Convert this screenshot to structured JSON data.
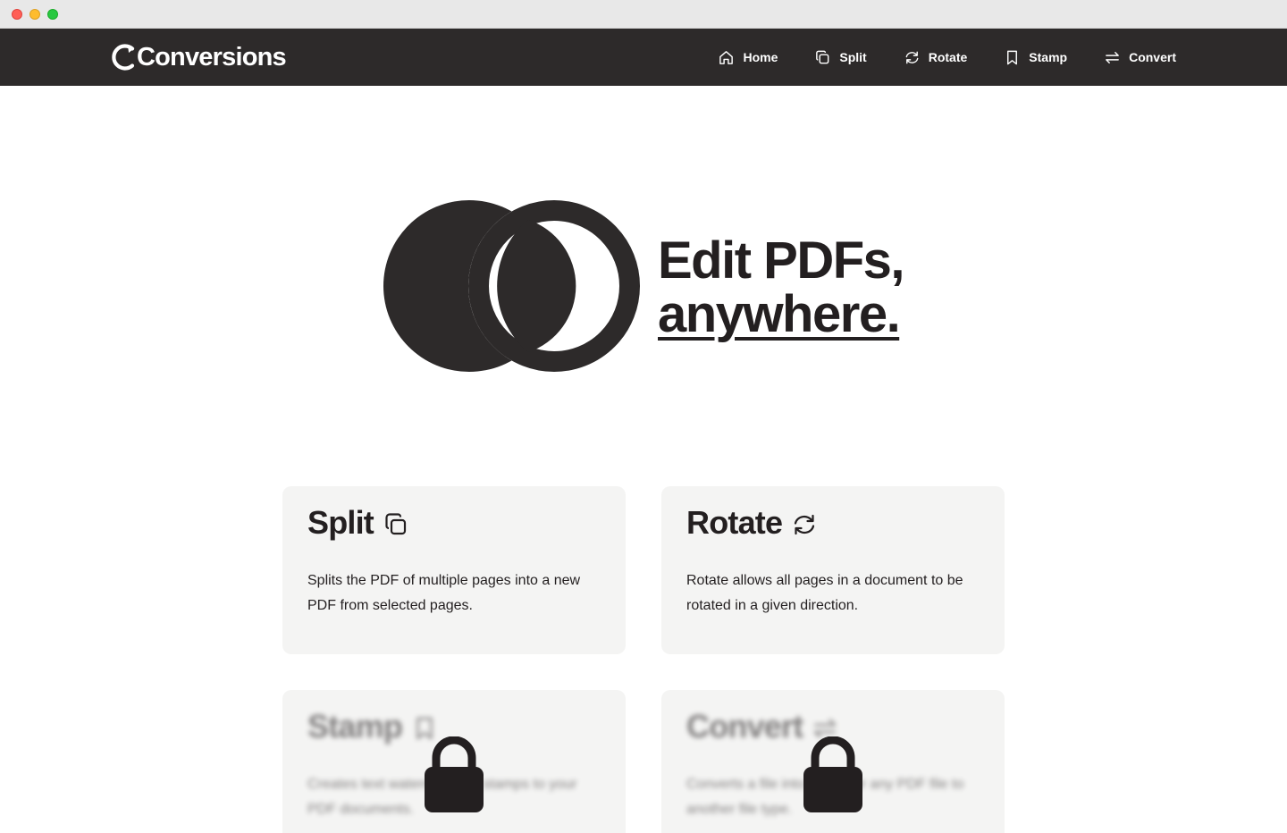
{
  "window": {
    "controls": [
      "close",
      "minimize",
      "maximize"
    ]
  },
  "navbar": {
    "brand": "Conversions",
    "links": [
      {
        "label": "Home",
        "icon": "home-icon"
      },
      {
        "label": "Split",
        "icon": "copy-icon"
      },
      {
        "label": "Rotate",
        "icon": "refresh-icon"
      },
      {
        "label": "Stamp",
        "icon": "bookmark-icon"
      },
      {
        "label": "Convert",
        "icon": "arrows-exchange-icon"
      }
    ]
  },
  "hero": {
    "line1": "Edit PDFs,",
    "line2": "anywhere."
  },
  "cards": [
    {
      "title": "Split",
      "icon": "copy-icon",
      "description": "Splits the PDF of multiple pages into a new PDF from selected pages.",
      "locked": false
    },
    {
      "title": "Rotate",
      "icon": "refresh-icon",
      "description": "Rotate allows all pages in a document to be rotated in a given direction.",
      "locked": false
    },
    {
      "title": "Stamp",
      "icon": "bookmark-icon",
      "description": "Creates text watermarks or stamps to your PDF documents.",
      "locked": true
    },
    {
      "title": "Convert",
      "icon": "arrows-exchange-icon",
      "description": "Converts a file into a PDF or any PDF file to another file type.",
      "locked": true
    }
  ],
  "colors": {
    "navbar_bg": "#2d2a2a",
    "brand_dark": "#231f20",
    "card_bg": "#f4f4f3",
    "page_bg": "#ffffff"
  }
}
